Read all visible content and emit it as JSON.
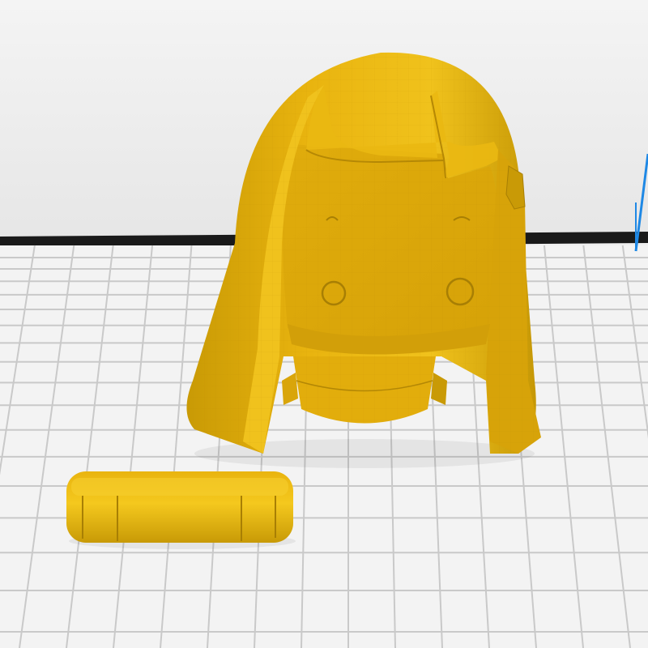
{
  "viewport": {
    "background_color": "#efefef",
    "horizon_color": "#1a1a1a",
    "bed_color": "#f3f3f3",
    "grid_color": "#c9c9c9",
    "bound_box_color": "#1e88e5"
  },
  "models": [
    {
      "name": "figurine-head",
      "color": "#e9b40f",
      "selected": false
    },
    {
      "name": "neck-peg",
      "color": "#e9b40f",
      "selected": false
    }
  ]
}
